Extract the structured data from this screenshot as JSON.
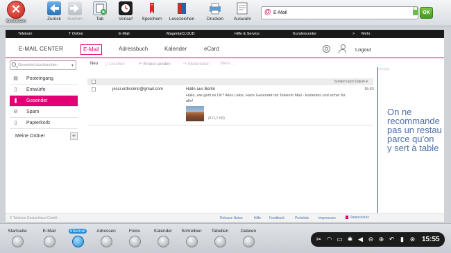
{
  "toolbar": {
    "close_label": "Schließen",
    "buttons": [
      {
        "label": "Zurück",
        "icon": "back-arrow-icon",
        "enabled": true
      },
      {
        "label": "Suchen",
        "icon": "forward-arrow-icon",
        "enabled": false
      },
      {
        "label": "Tab",
        "icon": "new-tab-icon",
        "enabled": true
      },
      {
        "label": "Verlauf",
        "icon": "history-icon",
        "enabled": true
      },
      {
        "label": "Speichern",
        "icon": "bookmark-add-icon",
        "enabled": true
      },
      {
        "label": "Lesezeichen",
        "icon": "bookmarks-book-icon",
        "enabled": true
      },
      {
        "label": "Drucken",
        "icon": "printer-icon",
        "enabled": true
      },
      {
        "label": "Auswahl",
        "icon": "selection-icon",
        "enabled": true
      }
    ],
    "address": "E-Mail",
    "ok_label": "OK"
  },
  "telekom_nav": [
    "Telekom",
    "T Online",
    "E-Mail",
    "MagentaCLOUD",
    "Hilfe & Service",
    "Kundencenter",
    ">",
    "Mehr"
  ],
  "mail_center": {
    "brand": "E-MAIL CENTER",
    "tabs": [
      "E-Mail",
      "Adressbuch",
      "Kalender",
      "eCard"
    ],
    "logout": "Logout",
    "search_placeholder": "Gesendet durchsuchen",
    "folders": [
      {
        "label": "Posteingang",
        "icon": "inbox-icon",
        "glyph": "▤"
      },
      {
        "label": "Entwürfe",
        "icon": "draft-icon",
        "glyph": "▯"
      },
      {
        "label": "Gesendet",
        "icon": "sent-icon",
        "glyph": "❚",
        "active": true
      },
      {
        "label": "Spam",
        "icon": "spam-icon",
        "glyph": "⊘"
      },
      {
        "label": "Papierkorb",
        "icon": "trash-icon",
        "glyph": "▯"
      }
    ],
    "meine_ordner": "Meine Ordner",
    "actions": {
      "new": "Neu",
      "delete": "Löschen",
      "reply": "Erneut senden",
      "forward": "Weiterleiten",
      "more": "Mehr ..."
    },
    "sort_label": "Sortiert nach Datum",
    "mail": {
      "from": "jessi.ordissimo@gmail.com",
      "subject": "Hallo aus Berlin",
      "preview": "Hallo, wie geht es Dir? Alles Liebe, Hans  Gesendet mit Telekom Mail - kostenlos und sicher für alle!",
      "attachment_size": "(813,2 KB)",
      "time": "15:53"
    },
    "ad_label": "Anzeige",
    "ad_text": [
      "On ne",
      "recommande",
      "pas un restau",
      "parce qu'on",
      "y sert à table"
    ]
  },
  "footer": {
    "copyright": "© Telekom Deutschland GmbH",
    "links": [
      "Release Notes",
      "Hilfe",
      "Feedback",
      "Preisliste",
      "Impressum"
    ],
    "datenschutz": "Datenschutz"
  },
  "dock": {
    "items": [
      {
        "label": "Startseite",
        "icon": "home-icon"
      },
      {
        "label": "E-Mail",
        "icon": "mail-icon"
      },
      {
        "label": "Internet",
        "icon": "globe-icon",
        "active": true
      },
      {
        "label": "Adressen",
        "icon": "contacts-icon"
      },
      {
        "label": "Fotos",
        "icon": "photos-icon"
      },
      {
        "label": "Kalender",
        "icon": "calendar-icon"
      },
      {
        "label": "Schreiben",
        "icon": "write-icon"
      },
      {
        "label": "Tabellen",
        "icon": "spreadsheet-icon"
      },
      {
        "label": "Dateien",
        "icon": "files-icon"
      }
    ],
    "time": "15:55"
  }
}
